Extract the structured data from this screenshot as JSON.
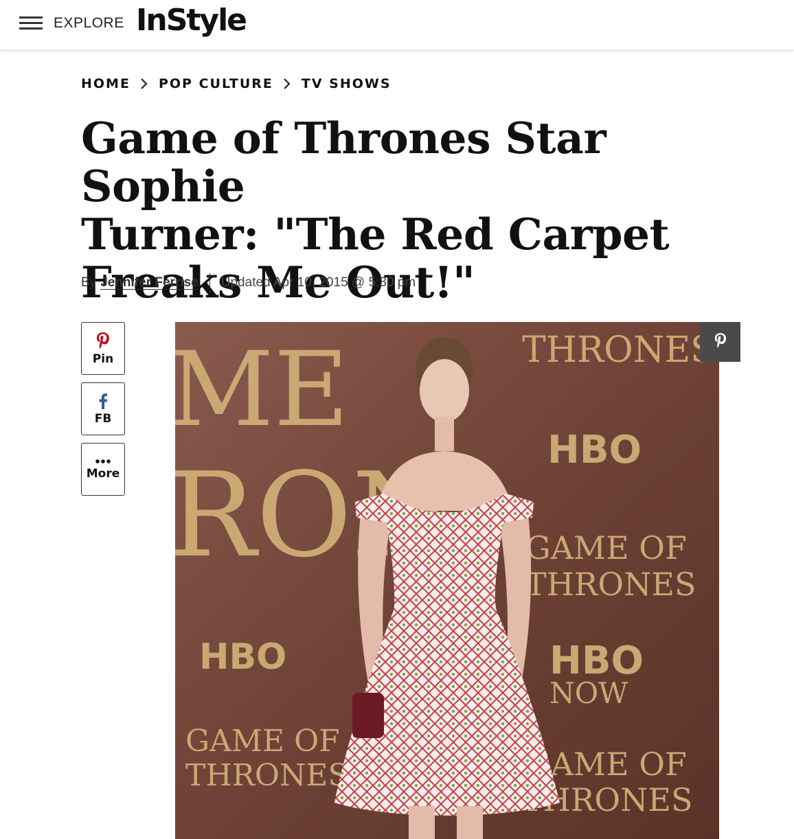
{
  "header": {
    "explore_label": "EXPLORE",
    "logo_text": "InStyle"
  },
  "breadcrumb": {
    "items": [
      "HOME",
      "POP CULTURE",
      "TV SHOWS"
    ]
  },
  "article": {
    "title_line1": "Game of Thrones Star Sophie",
    "title_line2": "Turner: \"The Red Carpet",
    "title_line3": "Freaks Me Out!\"",
    "by_label": "By",
    "author": "Jennifer Ferrise",
    "updated": "Updated Apr 10, 2015 @ 5:30 pm"
  },
  "share": {
    "pin_label": "Pin",
    "fb_label": "FB",
    "more_label": "More"
  },
  "hero_image": {
    "backdrop_text": {
      "game_fragment": "ME",
      "thrones_fragment": "RON",
      "thrones_top": "THRONES",
      "hbo": "HBO",
      "game_of": "GAME OF",
      "thrones": "THRONES",
      "hbo_now": "NOW"
    }
  },
  "colors": {
    "pinterest_red": "#bd081c",
    "facebook_blue": "#3b5998",
    "backdrop_dark": "#6e4236",
    "gold": "#c9a873"
  },
  "icons": {
    "menu": "hamburger-icon",
    "pinterest": "pinterest-icon",
    "facebook": "facebook-icon",
    "more": "ellipsis-icon",
    "chevron": "chevron-right-icon"
  }
}
